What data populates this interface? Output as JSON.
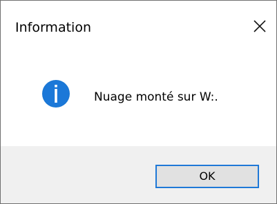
{
  "window": {
    "title": "Information"
  },
  "message": {
    "text": "Nuage monté sur W:."
  },
  "icons": {
    "status_icon": "information-icon",
    "close_icon": "close-icon"
  },
  "buttons": {
    "ok_label": "OK"
  },
  "colors": {
    "accent": "#1e78d7",
    "icon_blue": "#1976d2",
    "footer_bg": "#f0f0f0",
    "button_bg": "#e1e1e1",
    "window_border": "#6f6f6f"
  }
}
